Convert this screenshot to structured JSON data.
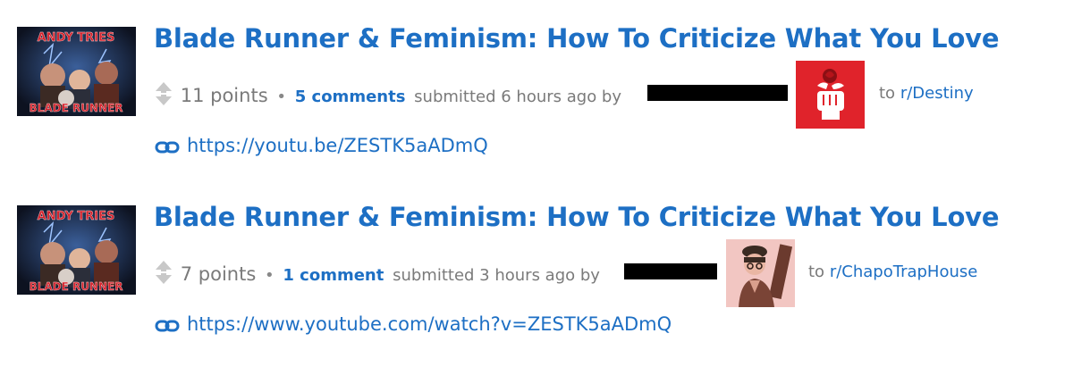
{
  "posts": [
    {
      "thumbnail_text_top": "ANDY TRIES",
      "thumbnail_text_bottom": "BLADE RUNNER",
      "title": "Blade Runner & Feminism: How To Criticize What You Love",
      "points": "11 points",
      "bullet": "•",
      "comments": "5 comments",
      "submitted": "submitted 6 hours ago by",
      "to_prefix": "to",
      "subreddit": "r/Destiny",
      "url": "https://youtu.be/ZESTK5aADmQ",
      "avatar_icon": "rose-fist-icon",
      "avatar_bg": "#e0232b"
    },
    {
      "thumbnail_text_top": "ANDY TRIES",
      "thumbnail_text_bottom": "BLADE RUNNER",
      "title": "Blade Runner & Feminism: How To Criticize What You Love",
      "points": "7 points",
      "bullet": "•",
      "comments": "1 comment",
      "submitted": "submitted 3 hours ago by",
      "to_prefix": "to",
      "subreddit": "r/ChapoTrapHouse",
      "url": "https://www.youtube.com/watch?v=ZESTK5aADmQ",
      "avatar_icon": "person-portrait-icon",
      "avatar_bg": "#f2c6c2"
    }
  ],
  "colors": {
    "link": "#1d6fc4",
    "meta": "#7a7a7a"
  }
}
